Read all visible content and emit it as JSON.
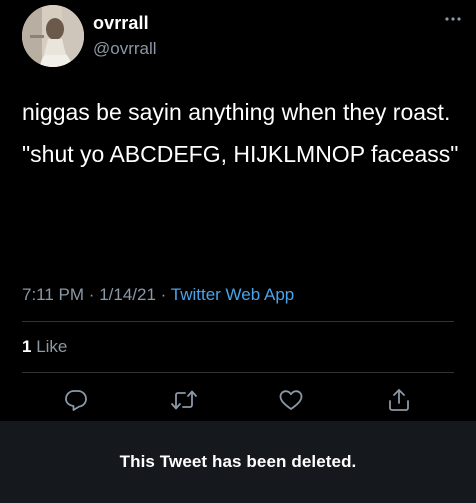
{
  "user": {
    "display_name": "ovrrall",
    "handle": "@ovrrall",
    "avatar_icon": "profile-photo"
  },
  "tweet": {
    "paragraphs": [
      "niggas be sayin anything when they roast.",
      "\"shut yo ABCDEFG, HIJKLMNOP faceass\""
    ],
    "time": "7:11 PM",
    "separator": "·",
    "date": "1/14/21",
    "source": "Twitter Web App"
  },
  "stats": {
    "likes_count": "1",
    "likes_label": "Like"
  },
  "actions": {
    "icons": [
      "reply-icon",
      "retweet-icon",
      "like-icon",
      "share-icon"
    ]
  },
  "banner": {
    "text": "This Tweet has been deleted."
  },
  "colors": {
    "background": "#000000",
    "text_primary": "#ffffff",
    "text_secondary": "#8b98a5",
    "link": "#4aa3e8",
    "divider": "#2f3336",
    "banner_bg": "#15181c"
  }
}
